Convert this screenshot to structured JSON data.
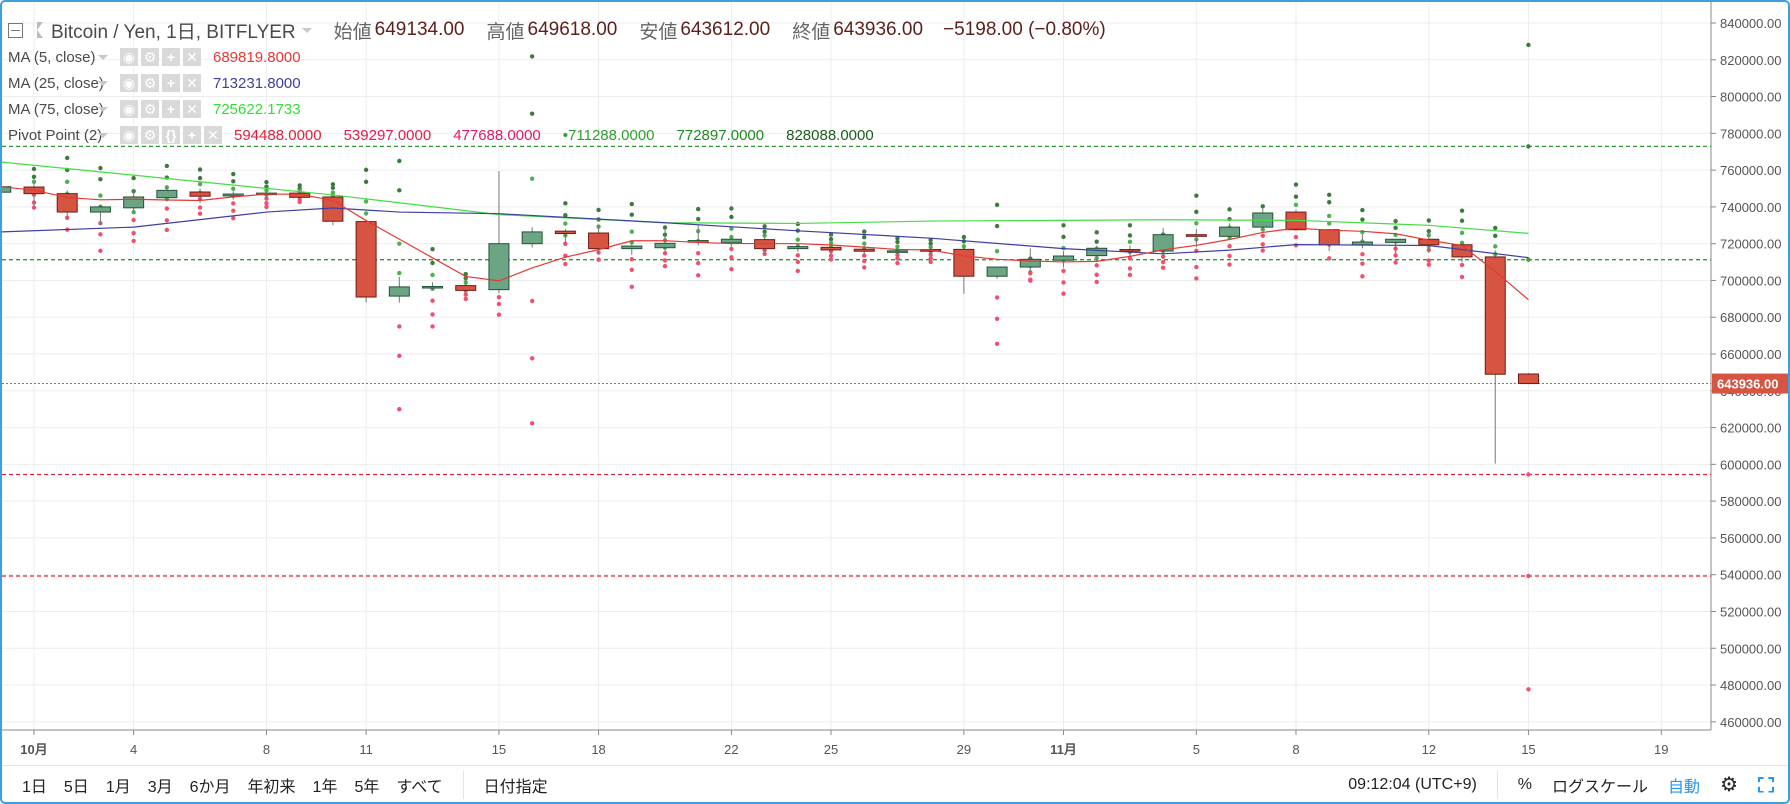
{
  "header": {
    "symbol": "Bitcoin / Yen, 1日, BITFLYER",
    "open_label": "始値",
    "open": "649134.00",
    "high_label": "高値",
    "high": "649618.00",
    "low_label": "安値",
    "low": "643612.00",
    "close_label": "終値",
    "close": "643936.00",
    "change": "−5198.00 (−0.80%)"
  },
  "indicators": [
    {
      "label": "MA (5, close)",
      "values": [
        "689819.8000"
      ],
      "colors": [
        "#e53935"
      ]
    },
    {
      "label": "MA (25, close)",
      "values": [
        "713231.8000"
      ],
      "colors": [
        "#3f3fa0"
      ]
    },
    {
      "label": "MA (75, close)",
      "values": [
        "725622.1733"
      ],
      "colors": [
        "#33dd33"
      ]
    },
    {
      "label": "Pivot Point (2)",
      "values": [
        "594488.0000",
        "539297.0000",
        "477688.0000",
        "•711288.0000",
        "772897.0000",
        "828088.0000"
      ],
      "colors": [
        "#e0203a",
        "#e8184a",
        "#e0186a",
        "#2ca02c",
        "#1e8a1e",
        "#1a5f1a"
      ]
    }
  ],
  "price_axis": {
    "labels": [
      "840000.00",
      "820000.00",
      "800000.00",
      "780000.00",
      "760000.00",
      "740000.00",
      "720000.00",
      "700000.00",
      "680000.00",
      "660000.00",
      "640000.00",
      "620000.00",
      "600000.00",
      "580000.00",
      "560000.00",
      "540000.00",
      "520000.00",
      "500000.00",
      "480000.00",
      "460000.00"
    ],
    "last_price_label": "643936.00"
  },
  "time_axis": [
    {
      "label": "10月",
      "day": 1
    },
    {
      "label": "4",
      "day": 4
    },
    {
      "label": "8",
      "day": 8
    },
    {
      "label": "11",
      "day": 11
    },
    {
      "label": "15",
      "day": 15
    },
    {
      "label": "18",
      "day": 18
    },
    {
      "label": "22",
      "day": 22
    },
    {
      "label": "25",
      "day": 25
    },
    {
      "label": "29",
      "day": 29
    },
    {
      "label": "11月",
      "day": 32
    },
    {
      "label": "5",
      "day": 36
    },
    {
      "label": "8",
      "day": 39
    },
    {
      "label": "12",
      "day": 43
    },
    {
      "label": "15",
      "day": 46
    },
    {
      "label": "19",
      "day": 50
    }
  ],
  "toolbar": {
    "ranges": [
      "1日",
      "5日",
      "1月",
      "3月",
      "6か月",
      "年初来",
      "1年",
      "5年",
      "すべて"
    ],
    "goto_date": "日付指定",
    "clock": "09:12:04 (UTC+9)",
    "percent": "%",
    "log_scale": "ログスケール",
    "auto": "自動"
  },
  "colors": {
    "up": "#6ba583",
    "up_border": "#225437",
    "down": "#d75442",
    "down_border": "#6f1b13",
    "ma5": "#e53935",
    "ma25": "#3f3fa0",
    "ma75": "#44dd44",
    "accent": "#3d9ee0"
  },
  "chart_data": {
    "type": "candlestick",
    "title": "Bitcoin / Yen, 1日, BITFLYER",
    "ylim": [
      460000,
      840000
    ],
    "last_price": 643936,
    "candles": [
      [
        748000,
        752000,
        745000,
        751000
      ],
      [
        750800,
        753500,
        740500,
        747200
      ],
      [
        747200,
        749000,
        734000,
        737200
      ],
      [
        737200,
        741400,
        730000,
        740000
      ],
      [
        739500,
        749600,
        738000,
        745400
      ],
      [
        745000,
        751000,
        743000,
        749000
      ],
      [
        748100,
        750000,
        742000,
        745800
      ],
      [
        746000,
        748500,
        744000,
        747000
      ],
      [
        747200,
        748000,
        745000,
        747500
      ],
      [
        747500,
        748500,
        744000,
        745200
      ],
      [
        745400,
        747200,
        730000,
        732200
      ],
      [
        732000,
        733000,
        688000,
        691000
      ],
      [
        691500,
        702000,
        688000,
        696500
      ],
      [
        696400,
        699000,
        694500,
        696700
      ],
      [
        697200,
        702500,
        693000,
        694600
      ],
      [
        695000,
        759500,
        693000,
        720000
      ],
      [
        720000,
        729000,
        718000,
        726400
      ],
      [
        726800,
        728000,
        719000,
        725500
      ],
      [
        725800,
        730000,
        715000,
        717300
      ],
      [
        717300,
        721000,
        714000,
        718700
      ],
      [
        717800,
        728000,
        716000,
        720200
      ],
      [
        720800,
        730000,
        719000,
        721700
      ],
      [
        720500,
        723500,
        718500,
        722400
      ],
      [
        722200,
        723500,
        715000,
        717300
      ],
      [
        717300,
        720000,
        715500,
        718400
      ],
      [
        718000,
        720500,
        714000,
        716600
      ],
      [
        717000,
        719000,
        714500,
        715900
      ],
      [
        715600,
        718000,
        714000,
        716100
      ],
      [
        716800,
        719000,
        714000,
        715900
      ],
      [
        716900,
        718000,
        692800,
        702300
      ],
      [
        702300,
        705000,
        701000,
        707300
      ],
      [
        707300,
        717400,
        705000,
        711500
      ],
      [
        711000,
        716000,
        707000,
        713300
      ],
      [
        713500,
        719000,
        710000,
        717500
      ],
      [
        716800,
        719000,
        713000,
        715900
      ],
      [
        716000,
        728500,
        713500,
        724900
      ],
      [
        724900,
        728000,
        718000,
        724000
      ],
      [
        724000,
        731000,
        723000,
        729000
      ],
      [
        729000,
        739000,
        728000,
        736700
      ],
      [
        737200,
        738500,
        727000,
        727600
      ],
      [
        727600,
        728000,
        716000,
        719400
      ],
      [
        719400,
        725000,
        717500,
        720900
      ],
      [
        720700,
        721000,
        713000,
        722400
      ],
      [
        722400,
        727000,
        715000,
        719400
      ],
      [
        719400,
        720000,
        710000,
        712800
      ],
      [
        712800,
        716400,
        600400,
        649000
      ],
      [
        649134,
        649618,
        643612,
        643936
      ]
    ],
    "ma25": [
      [
        0,
        726400
      ],
      [
        4,
        729000
      ],
      [
        8,
        737200
      ],
      [
        10,
        739400
      ],
      [
        12,
        737200
      ],
      [
        15,
        736300
      ],
      [
        20,
        731400
      ],
      [
        24,
        727000
      ],
      [
        28,
        723000
      ],
      [
        32,
        717300
      ],
      [
        35,
        714500
      ],
      [
        37,
        716500
      ],
      [
        39,
        719500
      ],
      [
        43,
        719000
      ],
      [
        46,
        712400
      ]
    ],
    "ma75": [
      [
        0,
        764400
      ],
      [
        10,
        746500
      ],
      [
        15,
        735800
      ],
      [
        20,
        731400
      ],
      [
        24,
        731000
      ],
      [
        28,
        732300
      ],
      [
        35,
        733000
      ],
      [
        39,
        732700
      ],
      [
        43,
        730000
      ],
      [
        46,
        725600
      ]
    ],
    "pivot_levels": {
      "s1": 594488,
      "s2": 539297,
      "s3": 477688,
      "p": 711288,
      "r1": 772897,
      "r2": 828088
    }
  }
}
